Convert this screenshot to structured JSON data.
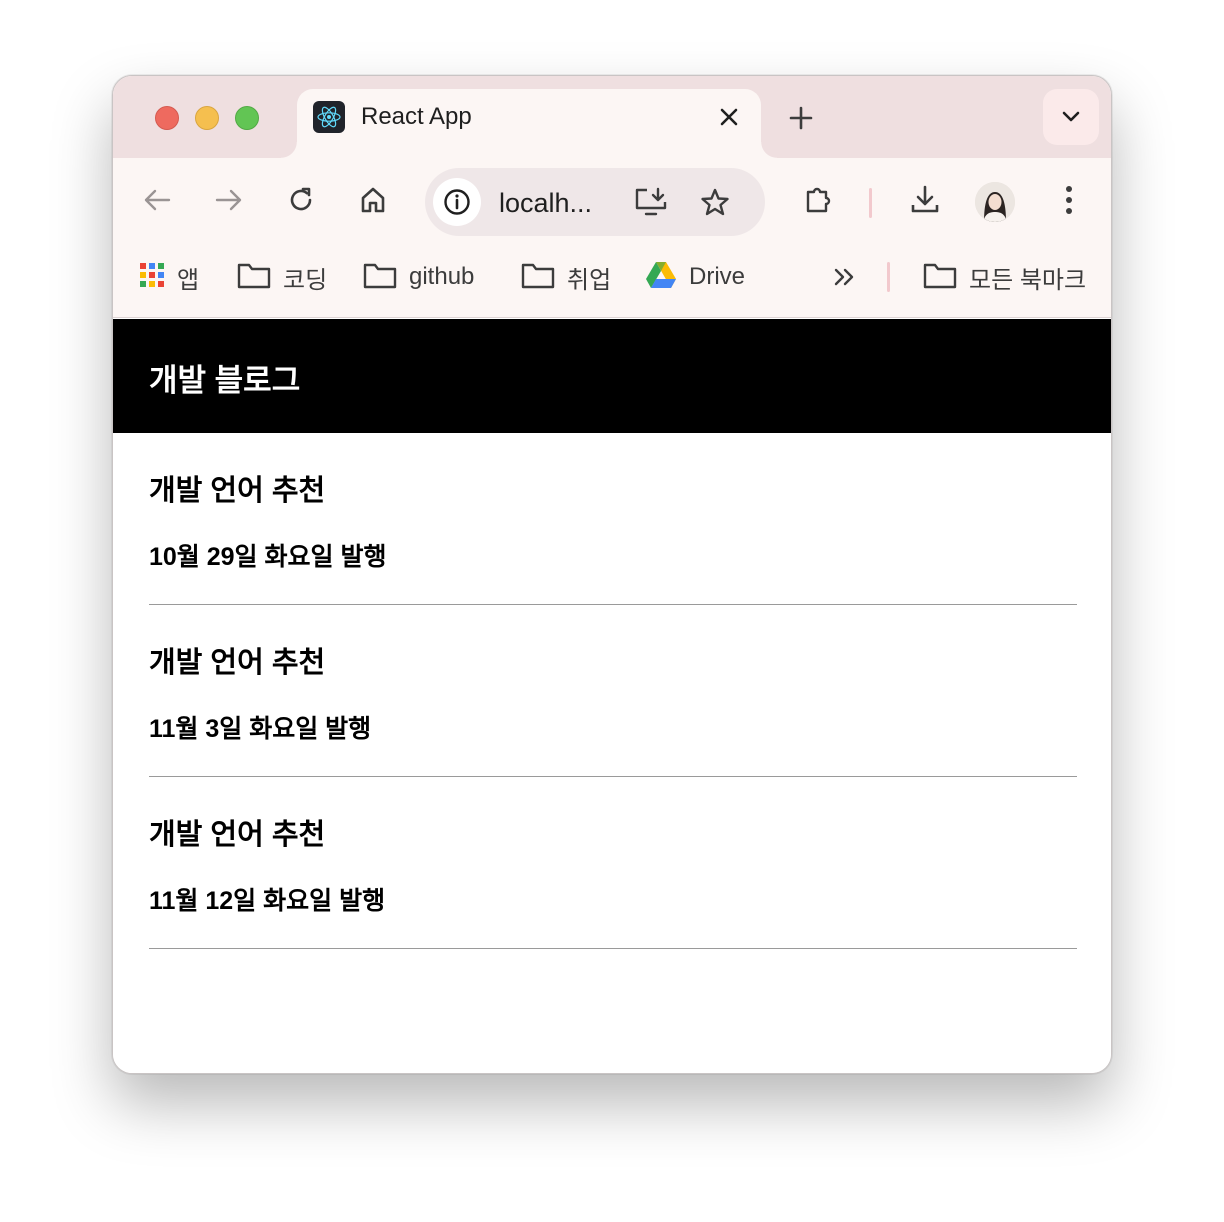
{
  "browser": {
    "tab": {
      "title": "React App"
    },
    "omnibox": {
      "url": "localh..."
    },
    "bookmarks": [
      {
        "label": "앱",
        "icon": "apps-grid-icon"
      },
      {
        "label": "코딩",
        "icon": "folder-icon"
      },
      {
        "label": "github",
        "icon": "folder-icon"
      },
      {
        "label": "취업",
        "icon": "folder-icon"
      },
      {
        "label": "Drive",
        "icon": "google-drive-icon"
      },
      {
        "label": "모든 북마크",
        "icon": "folder-icon"
      }
    ]
  },
  "page": {
    "header_title": "개발 블로그",
    "posts": [
      {
        "title": "개발 언어 추천",
        "date": "10월 29일 화요일 발행"
      },
      {
        "title": "개발 언어 추천",
        "date": "11월 3일 화요일 발행"
      },
      {
        "title": "개발 언어 추천",
        "date": "11월 12일 화요일 발행"
      }
    ]
  },
  "colors": {
    "tabstrip_bg": "#efdfe0",
    "toolbar_bg": "#fcf6f4",
    "header_bg": "#000000",
    "header_text": "#ffffff"
  }
}
